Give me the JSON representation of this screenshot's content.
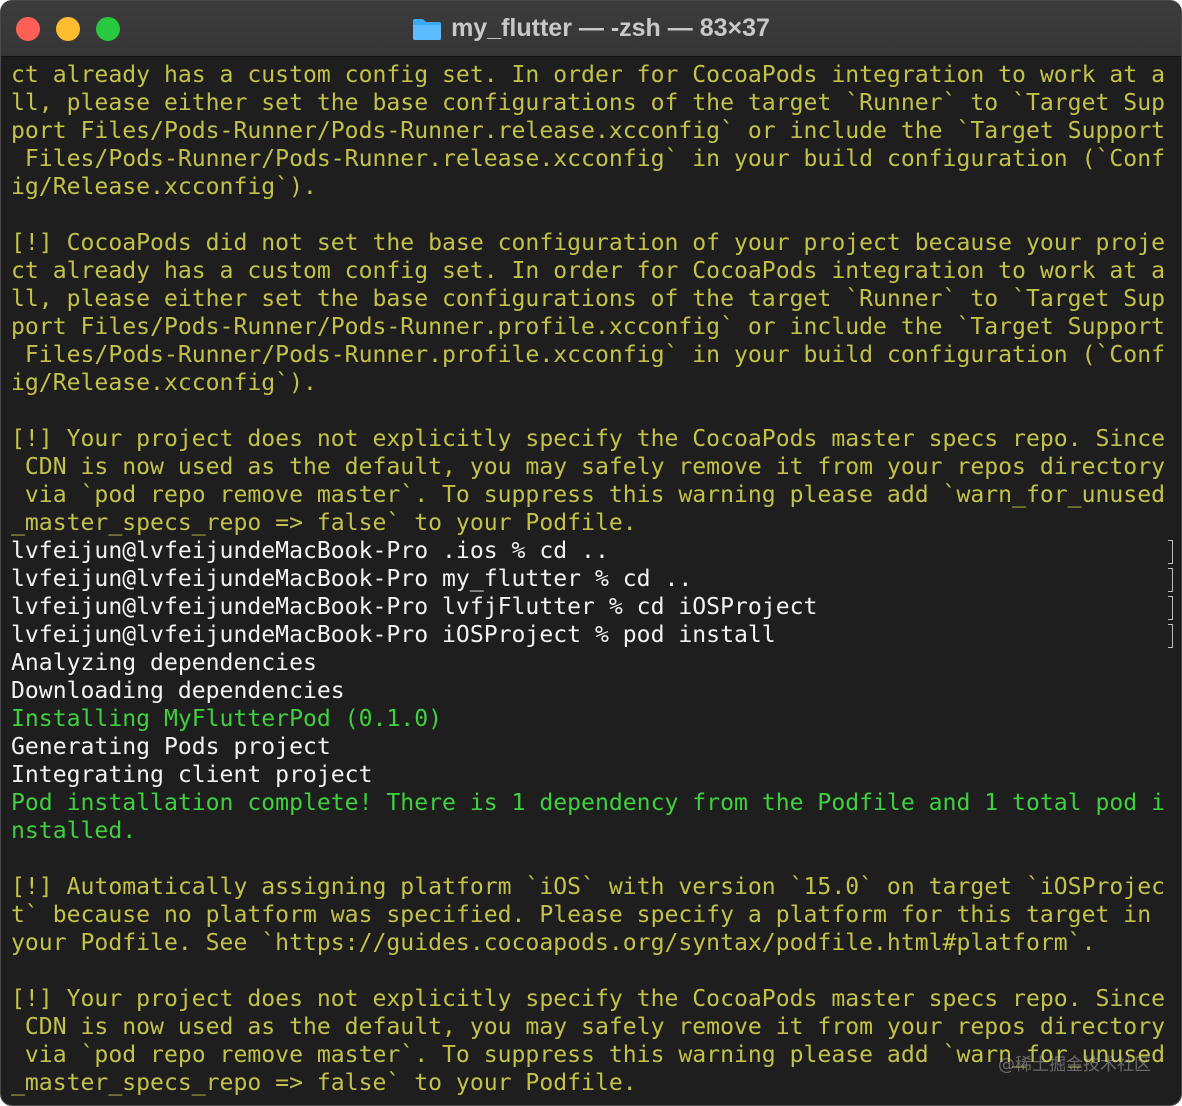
{
  "window": {
    "title": "my_flutter — -zsh — 83×37",
    "background": "#1e1e1e",
    "colors": {
      "yellow": "#c2c24a",
      "white": "#f2f2f2",
      "green": "#3fcf3f",
      "close": "#fe5f57",
      "minimize": "#febc2e",
      "zoom": "#28c840",
      "folder": "#3fa9f5"
    }
  },
  "terminal": {
    "lines": [
      {
        "text": "ct already has a custom config set. In order for CocoaPods integration to work at a",
        "color": "yellow",
        "prompt": false
      },
      {
        "text": "ll, please either set the base configurations of the target `Runner` to `Target Sup",
        "color": "yellow",
        "prompt": false
      },
      {
        "text": "port Files/Pods-Runner/Pods-Runner.release.xcconfig` or include the `Target Support",
        "color": "yellow",
        "prompt": false
      },
      {
        "text": " Files/Pods-Runner/Pods-Runner.release.xcconfig` in your build configuration (`Conf",
        "color": "yellow",
        "prompt": false
      },
      {
        "text": "ig/Release.xcconfig`).",
        "color": "yellow",
        "prompt": false
      },
      {
        "text": "",
        "color": "yellow",
        "prompt": false
      },
      {
        "text": "[!] CocoaPods did not set the base configuration of your project because your proje",
        "color": "yellow",
        "prompt": false
      },
      {
        "text": "ct already has a custom config set. In order for CocoaPods integration to work at a",
        "color": "yellow",
        "prompt": false
      },
      {
        "text": "ll, please either set the base configurations of the target `Runner` to `Target Sup",
        "color": "yellow",
        "prompt": false
      },
      {
        "text": "port Files/Pods-Runner/Pods-Runner.profile.xcconfig` or include the `Target Support",
        "color": "yellow",
        "prompt": false
      },
      {
        "text": " Files/Pods-Runner/Pods-Runner.profile.xcconfig` in your build configuration (`Conf",
        "color": "yellow",
        "prompt": false
      },
      {
        "text": "ig/Release.xcconfig`).",
        "color": "yellow",
        "prompt": false
      },
      {
        "text": "",
        "color": "yellow",
        "prompt": false
      },
      {
        "text": "[!] Your project does not explicitly specify the CocoaPods master specs repo. Since",
        "color": "yellow",
        "prompt": false
      },
      {
        "text": " CDN is now used as the default, you may safely remove it from your repos directory",
        "color": "yellow",
        "prompt": false
      },
      {
        "text": " via `pod repo remove master`. To suppress this warning please add `warn_for_unused",
        "color": "yellow",
        "prompt": false
      },
      {
        "text": "_master_specs_repo => false` to your Podfile.",
        "color": "yellow",
        "prompt": false
      },
      {
        "text": "lvfeijun@lvfeijundeMacBook-Pro .ios % cd ..",
        "color": "white",
        "prompt": true
      },
      {
        "text": "lvfeijun@lvfeijundeMacBook-Pro my_flutter % cd ..",
        "color": "white",
        "prompt": true
      },
      {
        "text": "lvfeijun@lvfeijundeMacBook-Pro lvfjFlutter % cd iOSProject",
        "color": "white",
        "prompt": true
      },
      {
        "text": "lvfeijun@lvfeijundeMacBook-Pro iOSProject % pod install",
        "color": "white",
        "prompt": true
      },
      {
        "text": "Analyzing dependencies",
        "color": "white",
        "prompt": false
      },
      {
        "text": "Downloading dependencies",
        "color": "white",
        "prompt": false
      },
      {
        "text": "Installing MyFlutterPod (0.1.0)",
        "color": "green",
        "prompt": false
      },
      {
        "text": "Generating Pods project",
        "color": "white",
        "prompt": false
      },
      {
        "text": "Integrating client project",
        "color": "white",
        "prompt": false
      },
      {
        "text": "Pod installation complete! There is 1 dependency from the Podfile and 1 total pod i",
        "color": "green",
        "prompt": false
      },
      {
        "text": "nstalled.",
        "color": "green",
        "prompt": false
      },
      {
        "text": "",
        "color": "yellow",
        "prompt": false
      },
      {
        "text": "[!] Automatically assigning platform `iOS` with version `15.0` on target `iOSProjec",
        "color": "yellow",
        "prompt": false
      },
      {
        "text": "t` because no platform was specified. Please specify a platform for this target in",
        "color": "yellow",
        "prompt": false
      },
      {
        "text": "your Podfile. See `https://guides.cocoapods.org/syntax/podfile.html#platform`.",
        "color": "yellow",
        "prompt": false
      },
      {
        "text": "",
        "color": "yellow",
        "prompt": false
      },
      {
        "text": "[!] Your project does not explicitly specify the CocoaPods master specs repo. Since",
        "color": "yellow",
        "prompt": false
      },
      {
        "text": " CDN is now used as the default, you may safely remove it from your repos directory",
        "color": "yellow",
        "prompt": false
      },
      {
        "text": " via `pod repo remove master`. To suppress this warning please add `warn_for_unused",
        "color": "yellow",
        "prompt": false
      },
      {
        "text": "_master_specs_repo => false` to your Podfile.",
        "color": "yellow",
        "prompt": false
      }
    ]
  },
  "watermark": "@稀土掘金技术社区"
}
